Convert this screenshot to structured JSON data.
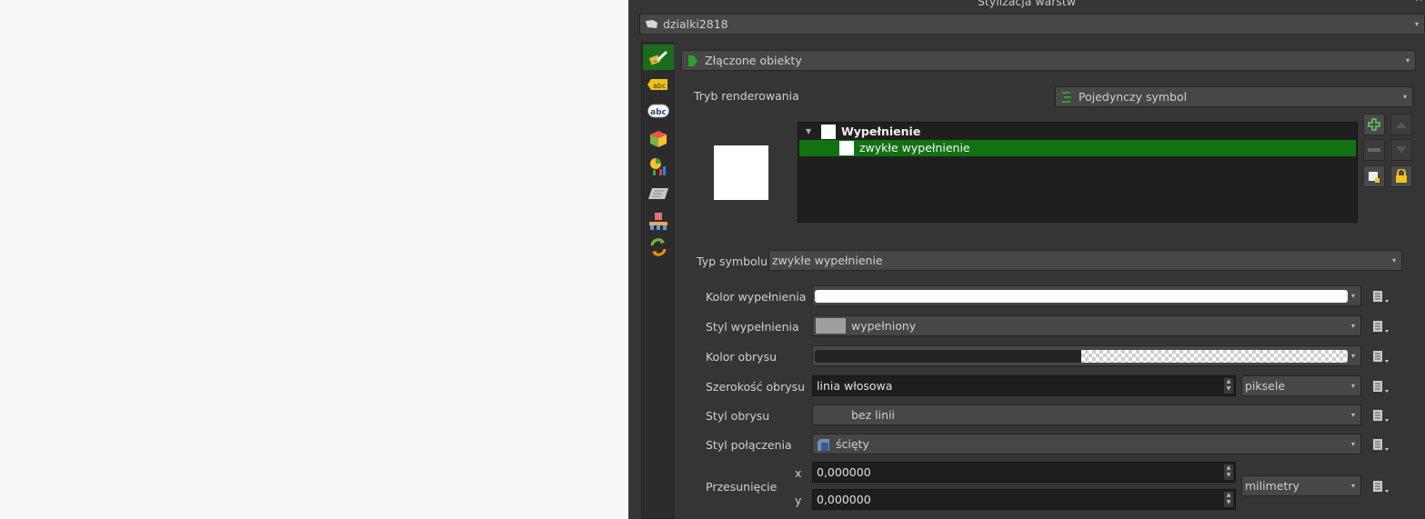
{
  "panel": {
    "title": "Stylizacja warstw",
    "close_glyph": "✕"
  },
  "layer_select": {
    "value": "dzialki2818",
    "icon": "polygon-layer-icon"
  },
  "sidebar": {
    "items": [
      {
        "name": "symbology",
        "icon": "paintbrush-icon",
        "active": true
      },
      {
        "name": "labels",
        "icon": "label-abc-icon",
        "text": "abc"
      },
      {
        "name": "masks",
        "icon": "mask-abc-icon",
        "text": "abc"
      },
      {
        "name": "3d-view",
        "icon": "3d-cube-icon"
      },
      {
        "name": "diagrams",
        "icon": "diagram-icon"
      },
      {
        "name": "fields",
        "icon": "fields-icon"
      },
      {
        "name": "elevation",
        "icon": "elevation-icon"
      },
      {
        "name": "history",
        "icon": "history-icon"
      }
    ]
  },
  "renderer_type": {
    "value": "Złączone obiekty"
  },
  "render_mode": {
    "label": "Tryb renderowania",
    "value": "Pojedynczy symbol"
  },
  "symbol_tree": {
    "root": {
      "label": "Wypełnienie",
      "expand_glyph": "▼"
    },
    "child": {
      "label": "zwykłe wypełnienie",
      "selected": true
    }
  },
  "symbol_type": {
    "label": "Typ symbolu",
    "value": "zwykłe wypełnienie"
  },
  "properties": {
    "fill_color": {
      "label": "Kolor wypełnienia",
      "color": "#ffffff"
    },
    "fill_style": {
      "label": "Styl wypełnienia",
      "value": "wypełniony"
    },
    "stroke_color": {
      "label": "Kolor obrysu",
      "color": "#232323"
    },
    "stroke_width": {
      "label": "Szerokość obrysu",
      "value": "linia włosowa",
      "unit": "piksele"
    },
    "stroke_style": {
      "label": "Styl obrysu",
      "value": "bez linii"
    },
    "join_style": {
      "label": "Styl połączenia",
      "value": "ścięty"
    },
    "offset": {
      "label": "Przesunięcie",
      "x_label": "x",
      "x": "0,000000",
      "y_label": "y",
      "y": "0,000000",
      "unit": "milimetry"
    }
  },
  "colors": {
    "accent": "#1b6d1b",
    "selection": "#127212",
    "panel": "#353535",
    "field": "#1e1e1e"
  }
}
